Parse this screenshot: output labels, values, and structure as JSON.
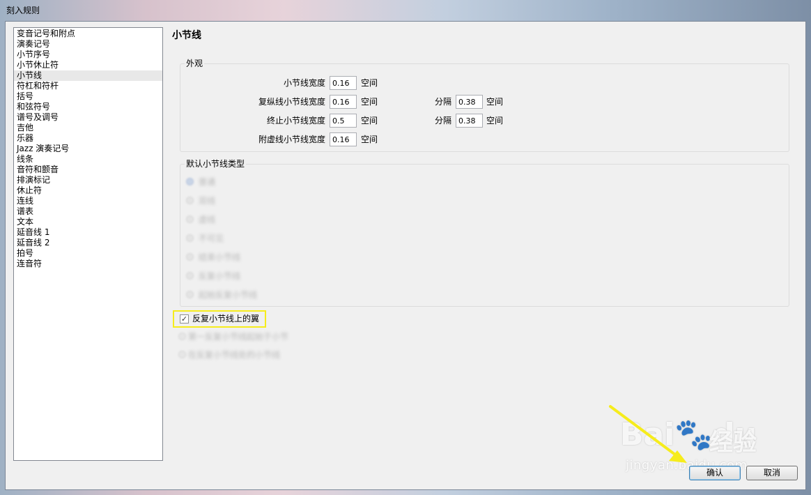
{
  "window": {
    "title": "刻入规则"
  },
  "sidebar": {
    "selected_index": 5,
    "items": [
      "变音记号和附点",
      "演奏记号",
      "小节序号",
      "小节休止符",
      "小节线",
      "符杠和符杆",
      "括号",
      "和弦符号",
      "谱号及调号",
      "吉他",
      "乐器",
      "Jazz 演奏记号",
      "线条",
      "音符和颤音",
      "排演标记",
      "休止符",
      "连线",
      "谱表",
      "文本",
      "延音线 1",
      "延音线 2",
      "拍号",
      "连音符"
    ]
  },
  "page": {
    "title": "小节线"
  },
  "appearance": {
    "label": "外观",
    "rows": [
      {
        "label": "小节线宽度",
        "value": "0.16",
        "unit": "空间"
      },
      {
        "label": "复纵线小节线宽度",
        "value": "0.16",
        "unit": "空间",
        "sep_label": "分隔",
        "sep_value": "0.38",
        "sep_unit": "空间"
      },
      {
        "label": "终止小节线宽度",
        "value": "0.5",
        "unit": "空间",
        "sep_label": "分隔",
        "sep_value": "0.38",
        "sep_unit": "空间"
      },
      {
        "label": "附虚线小节线宽度",
        "value": "0.16",
        "unit": "空间"
      }
    ]
  },
  "default_type": {
    "label": "默认小节线类型",
    "checked_index": 0,
    "options": [
      "普通",
      "双线",
      "虚线",
      "不可见",
      "结束小节线",
      "反复小节线",
      "起始反复小节线"
    ]
  },
  "repeat_wings": {
    "label": "反复小节线上的翼",
    "checked": true
  },
  "blurred_options": [
    "第一反复小节线起始于小节",
    "在反复小节线处的小节线"
  ],
  "buttons": {
    "ok": "确认",
    "cancel": "取消"
  },
  "watermark": {
    "brand": "Bai",
    "brand2": "du",
    "cn": "经验",
    "url": "jingyan.baidu.com"
  },
  "annotation_color": "#f6ec1c"
}
